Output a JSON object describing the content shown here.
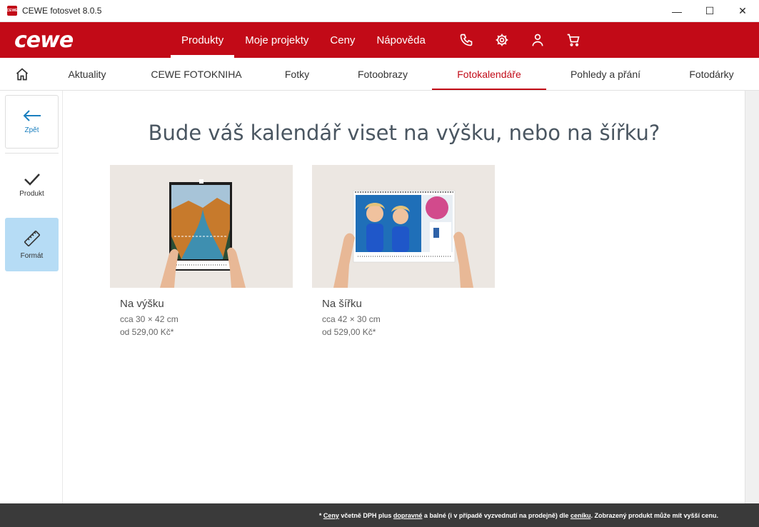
{
  "window": {
    "title": "CEWE fotosvet 8.0.5",
    "app_icon_text": "CEWE",
    "minimize": "—",
    "maximize": "☐",
    "close": "✕"
  },
  "brand": {
    "logo": "cewe",
    "color": "#c20a17"
  },
  "mainnav": [
    {
      "label": "Produkty"
    },
    {
      "label": "Moje projekty"
    },
    {
      "label": "Ceny"
    },
    {
      "label": "Nápověda"
    }
  ],
  "categories": [
    {
      "label": "Aktuality"
    },
    {
      "label": "CEWE FOTOKNIHA"
    },
    {
      "label": "Fotky"
    },
    {
      "label": "Fotoobrazy"
    },
    {
      "label": "Fotokalendáře"
    },
    {
      "label": "Pohledy a přání"
    },
    {
      "label": "Fotodárky"
    }
  ],
  "sidebar": {
    "back": "Zpět",
    "product": "Produkt",
    "format": "Formát"
  },
  "main": {
    "heading": "Bude váš kalendář viset na výšku, nebo na šířku?",
    "cards": [
      {
        "title": "Na výšku",
        "size": "cca 30 × 42 cm",
        "price": "od 529,00 Kč*"
      },
      {
        "title": "Na šířku",
        "size": "cca 42 × 30 cm",
        "price": "od 529,00 Kč*"
      }
    ]
  },
  "footer": {
    "prefix": "* ",
    "ceny": "Ceny",
    "t1": " včetně DPH plus ",
    "dopravne": "dopravné",
    "t2": " a balné (i v případě vyzvednutí na prodejně) dle ",
    "ceniku": "ceníku",
    "t3": ". Zobrazený produkt může mít vyšší cenu."
  }
}
